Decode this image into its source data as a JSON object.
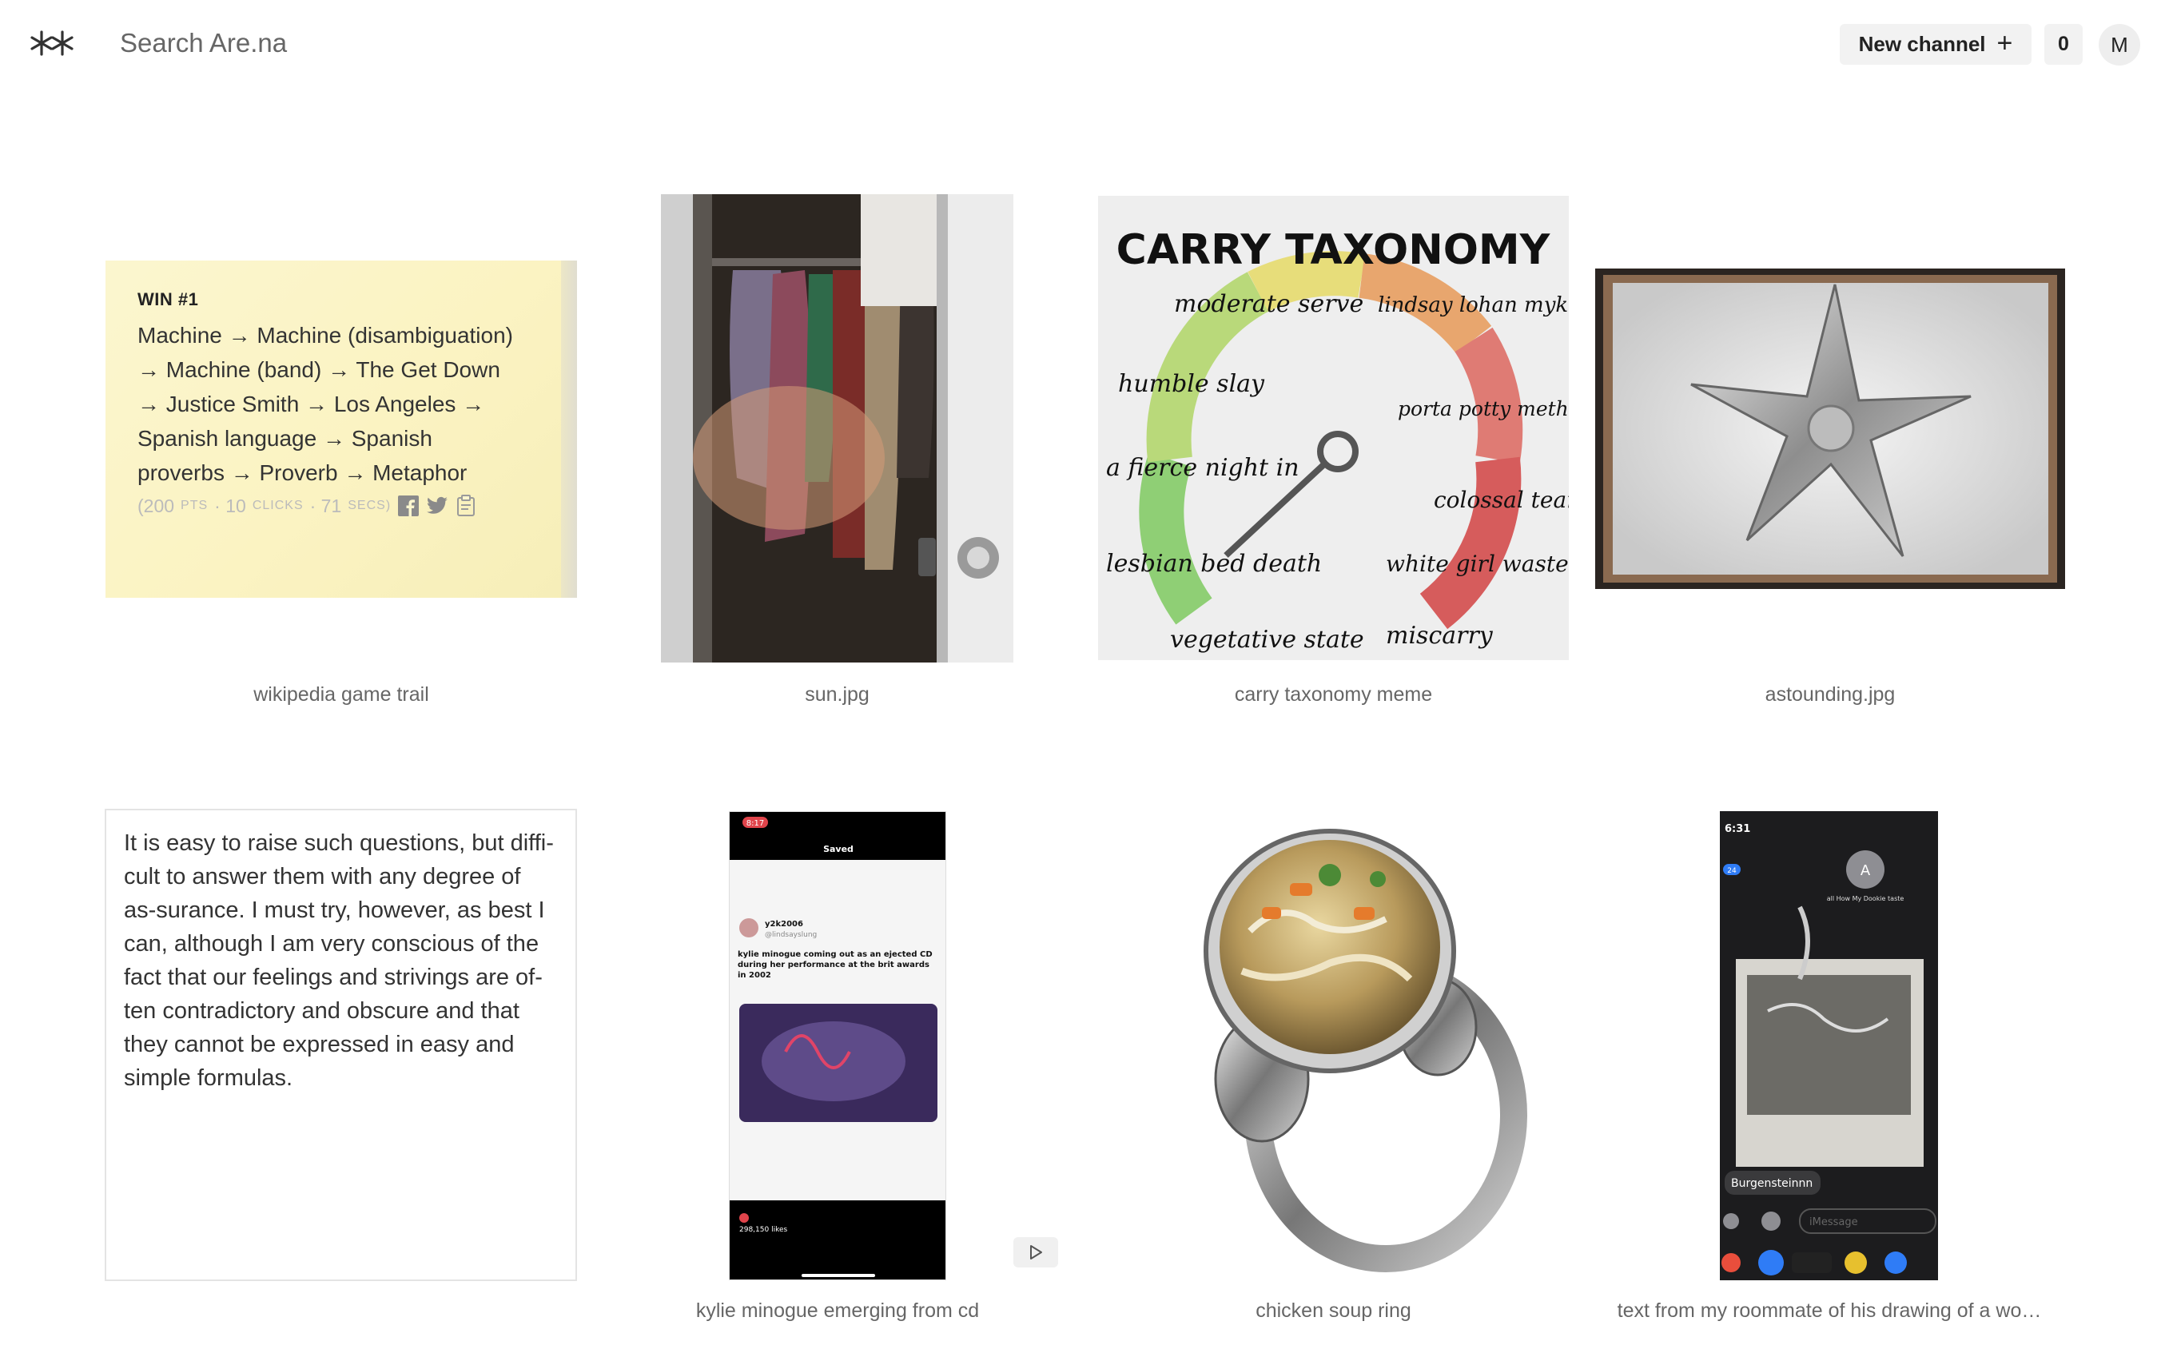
{
  "header": {
    "logo_icon": "arena-asterisk-logo",
    "search_placeholder": "Search Are.na",
    "new_channel_label": "New channel",
    "new_channel_icon": "plus-icon",
    "notification_count": "0",
    "avatar_initial": "M"
  },
  "blocks": [
    {
      "type": "text-card",
      "win_label": "WIN #1",
      "trail": "Machine → Machine (disambiguation) → Machine (band) → The Get Down → Justice Smith → Los Angeles → Spanish language → Spanish proverbs → Proverb → Metaphor",
      "stats": {
        "pts_value": "(200",
        "pts_label": "PTS",
        "clicks_value": "· 10",
        "clicks_label": "CLICKS",
        "secs_value": "· 71",
        "secs_label": "SECS)"
      },
      "share_icons": [
        "facebook-icon",
        "twitter-icon",
        "clipboard-icon"
      ],
      "caption": "wikipedia game trail"
    },
    {
      "type": "image",
      "caption": "sun.jpg"
    },
    {
      "type": "image",
      "caption": "carry taxonomy meme",
      "meme": {
        "title": "CARRY TAXONOMY",
        "labels": [
          "moderate serve",
          "lindsay lohan mykonos",
          "humble slay",
          "porta potty meth spiral",
          "a fierce night in",
          "colossal tear",
          "lesbian bed death",
          "white girl wasted",
          "vegetative state",
          "miscarry"
        ]
      }
    },
    {
      "type": "image",
      "caption": "astounding.jpg"
    },
    {
      "type": "text",
      "body": "It is easy to raise such questions, but diffi-cult to answer them with any degree of as-surance. I must try, however, as best I can, although I am very conscious of the fact that our feelings and strivings are of-ten contradictory and obscure and that they cannot be expressed in easy and simple formulas.",
      "caption": ""
    },
    {
      "type": "media",
      "caption": "kylie minogue emerging from cd",
      "play_icon": "play-icon",
      "screen": {
        "time": "8:17",
        "header": "Saved",
        "handle": "y2k2006",
        "subhandle": "@lindsayslung",
        "post_text": "kylie minogue coming out as an ejected CD during her performance at the brit awards in 2002",
        "likes": "298,150 likes"
      }
    },
    {
      "type": "image",
      "caption": "chicken soup ring"
    },
    {
      "type": "image",
      "caption": "text from my roommate of his drawing of a wo…",
      "screen": {
        "time": "6:31",
        "contact_initial": "A",
        "contact_line": "all How My Dookie taste",
        "badge": "24",
        "sender": "Burgensteinnn",
        "message_placeholder": "iMessage"
      }
    }
  ],
  "colors": {
    "accent_bg": "#f2f2f2",
    "text_muted": "#666666",
    "wiki_card_bg": "#fbf6cf"
  }
}
